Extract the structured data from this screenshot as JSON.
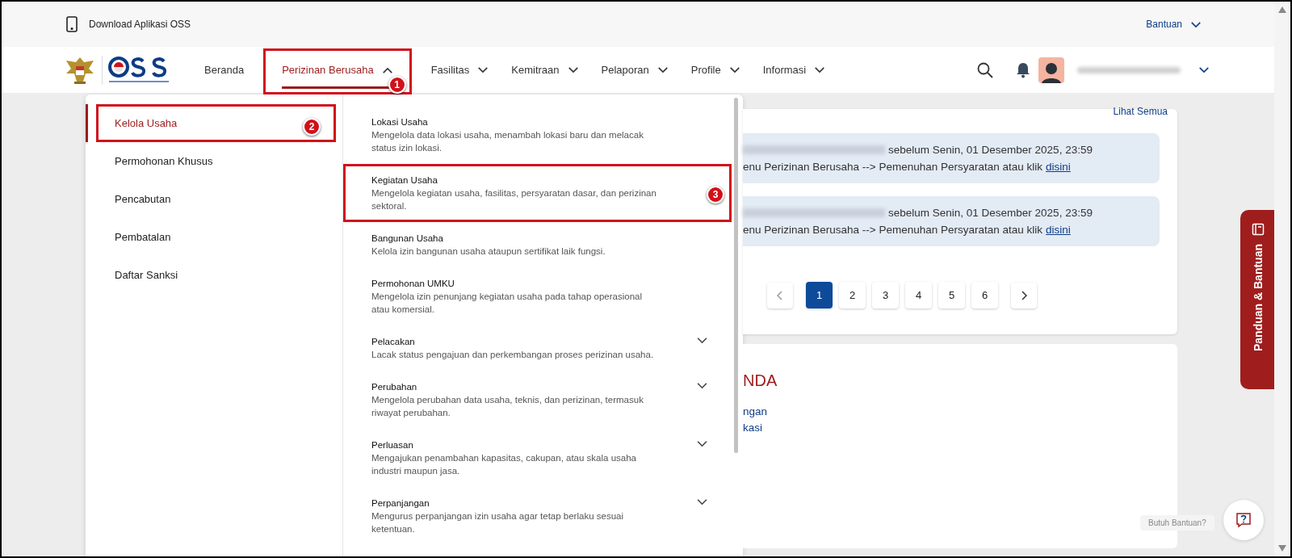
{
  "top_bar": {
    "download_label": "Download Aplikasi OSS",
    "help_menu": "Bantuan"
  },
  "nav": {
    "items": [
      {
        "label": "Beranda",
        "selected": false,
        "kind": "link"
      },
      {
        "label": "Perizinan Berusaha",
        "selected": true,
        "kind": "menu",
        "expanded": true,
        "callout": "1"
      },
      {
        "label": "Fasilitas",
        "selected": false,
        "kind": "menu",
        "expanded": false
      },
      {
        "label": "Kemitraan",
        "selected": false,
        "kind": "menu",
        "expanded": false
      },
      {
        "label": "Pelaporan",
        "selected": false,
        "kind": "menu",
        "expanded": false
      },
      {
        "label": "Profile",
        "selected": false,
        "kind": "menu",
        "expanded": false
      },
      {
        "label": "Informasi",
        "selected": false,
        "kind": "menu",
        "expanded": false
      }
    ]
  },
  "dropdown": {
    "categories": [
      {
        "label": "Kelola Usaha",
        "selected": true,
        "callout": "2"
      },
      {
        "label": "Permohonan Khusus",
        "selected": false
      },
      {
        "label": "Pencabutan",
        "selected": false
      },
      {
        "label": "Pembatalan",
        "selected": false
      },
      {
        "label": "Daftar Sanksi",
        "selected": false
      }
    ],
    "items": [
      {
        "kind": "link",
        "title": "Lokasi Usaha",
        "description": "Mengelola data lokasi usaha, menambah lokasi baru dan melacak status izin lokasi."
      },
      {
        "kind": "link",
        "title": "Kegiatan Usaha",
        "description": "Mengelola kegiatan usaha, fasilitas, persyaratan dasar, dan perizinan sektoral.",
        "callout": "3"
      },
      {
        "kind": "link",
        "title": "Bangunan Usaha",
        "description": "Kelola izin bangunan usaha ataupun sertifikat laik fungsi."
      },
      {
        "kind": "link",
        "title": "Permohonan UMKU",
        "description": "Mengelola izin penunjang kegiatan usaha pada tahap operasional atau komersial."
      },
      {
        "kind": "group",
        "expanded": false,
        "title": "Pelacakan",
        "description": "Lacak status pengajuan dan perkembangan proses perizinan usaha."
      },
      {
        "kind": "group",
        "expanded": false,
        "title": "Perubahan",
        "description": "Mengelola perubahan data usaha, teknis, dan perizinan, termasuk riwayat perubahan."
      },
      {
        "kind": "group",
        "expanded": false,
        "title": "Perluasan",
        "description": "Mengajukan penambahan kapasitas, cakupan, atau skala usaha industri maupun jasa."
      },
      {
        "kind": "group",
        "expanded": false,
        "title": "Perpanjangan",
        "description": "Mengurus perpanjangan izin usaha agar tetap berlaku sesuai ketentuan."
      }
    ]
  },
  "notifications": {
    "see_all": "Lihat Semua",
    "items": [
      {
        "line_1": "sebelum Senin, 01 Desember 2025, 23:59",
        "line_2": "enu Perizinan Berusaha --> Pemenuhan Persyaratan atau klik",
        "link": "disini"
      },
      {
        "line_1": "sebelum Senin, 01 Desember 2025, 23:59",
        "line_2": "enu Perizinan Berusaha --> Pemenuhan Persyaratan atau klik",
        "link": "disini"
      }
    ]
  },
  "pagination": {
    "pages": [
      {
        "label": "1",
        "selected": true
      },
      {
        "label": "2",
        "selected": false
      },
      {
        "label": "3",
        "selected": false
      },
      {
        "label": "4",
        "selected": false
      },
      {
        "label": "5",
        "selected": false
      },
      {
        "label": "6",
        "selected": false
      }
    ]
  },
  "second_card": {
    "heading": "NDA",
    "links": [
      "ngan",
      "kasi"
    ]
  },
  "side_tab": {
    "label": "Panduan & Bantuan"
  },
  "help": {
    "tooltip": "Butuh Bantuan?"
  }
}
